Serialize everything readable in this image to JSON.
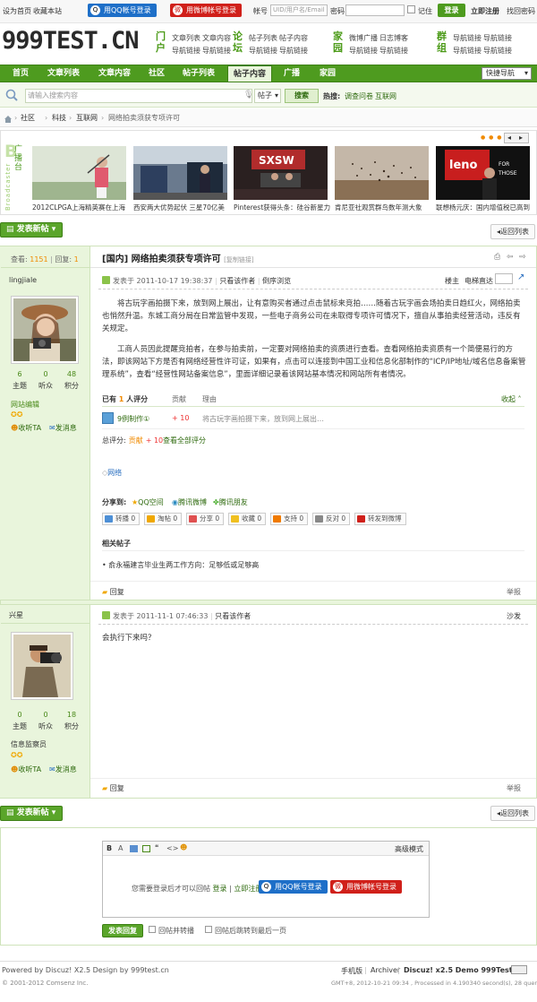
{
  "topbar": {
    "set_home": "设为首页",
    "bookmark": "收藏本站",
    "qq_login": "用QQ帐号登录",
    "weibo_login": "用微博帐号登录",
    "account_label": "帐号",
    "account_placeholder": "UID/用户名/Email",
    "password_label": "密码",
    "remember": "记住",
    "login": "登录",
    "register": "立即注册",
    "forgot": "找回密码"
  },
  "logo": "999TEST.CN",
  "subnav": [
    {
      "head": "门户",
      "items": [
        "文章列表",
        "文章内容",
        "导航链接",
        "导航链接"
      ]
    },
    {
      "head": "论坛",
      "items": [
        "帖子列表",
        "帖子内容",
        "导航链接",
        "导航链接"
      ]
    },
    {
      "head": "家园",
      "items": [
        "微博广播",
        "日志博客",
        "导航链接",
        "导航链接"
      ]
    },
    {
      "head": "群组",
      "items": [
        "导航链接",
        "导航链接",
        "导航链接",
        "导航链接"
      ]
    }
  ],
  "mainnav": {
    "items": [
      "首页",
      "文章列表",
      "文章内容",
      "社区",
      "帖子列表",
      "帖子内容",
      "广播",
      "家园"
    ],
    "active": 5,
    "quick": "快捷导航"
  },
  "search": {
    "placeholder": "请输入搜索内容",
    "scope": "帖子",
    "button": "搜索",
    "hot_label": "热搜:",
    "hot": [
      "调查问卷",
      "互联网"
    ]
  },
  "breadcrumb": [
    "社区",
    "科技",
    "互联网",
    "网络拍卖须获专项许可"
  ],
  "broadcast": {
    "label": "广播台",
    "side_text": "Broadcaster",
    "dots": "● ● ●",
    "items": [
      "2012CLPGA上海精英赛在上海",
      "西安两大优势起伏 三星70亿美",
      "Pinterest获得头条：硅谷新星力",
      "肯尼亚社观赏群鸟数年测大象",
      "联想杨元庆：国内增值税已高到"
    ]
  },
  "actions": {
    "new_post": "发表新帖",
    "back_list": "返回列表"
  },
  "thread": {
    "views_label": "查看:",
    "views": "1151",
    "replies_label": "回复:",
    "replies": "1",
    "category": "[国内]",
    "title": "网络拍卖须获专项许可",
    "copy_link": "[复制链接]"
  },
  "post1": {
    "author": "lingjiale",
    "meta": "发表于 2011-10-17 19:38:37",
    "only_author": "只看该作者",
    "reverse": "倒序浏览",
    "floor": "楼主",
    "teleport": "电梯直达",
    "para1": "将古玩字画拍摄下来，放到网上展出，让有意购买者通过点击鼠标来竞拍……随着古玩字画会场拍卖日趋红火，网络拍卖也悄然升温。东城工商分局在日常监管中发现，一些电子商务公司在未取得专项许可情况下，擅自从事拍卖经营活动，违反有关规定。",
    "para2": "工商人员因此提醒竞拍者，在参与拍卖前，一定要对网络拍卖的资质进行查看。查看网络拍卖资质有一个简便易行的方法，即该网站下方是否有网络经营性许可证，如果有，点击可以连接到中国工业和信息化部制作的“ICP/IP地址/域名信息备案管理系统”，查看“经营性网站备案信息”，里面详细记录着该网站基本情况和网站所有者情况。",
    "stats": [
      {
        "n": "6",
        "l": "主题"
      },
      {
        "n": "0",
        "l": "听众"
      },
      {
        "n": "48",
        "l": "积分"
      }
    ],
    "rank": "网站编辑",
    "follow": "收听TA",
    "message": "发消息",
    "rate": {
      "count_prefix": "已有",
      "count": "1",
      "count_suffix": "人评分",
      "col_contrib": "贡献",
      "col_reason": "理由",
      "collapse": "收起",
      "user": "9例制作①",
      "value": "+ 10",
      "reason": "将古玩字画拍摄下来，放到网上展出…",
      "total_label": "总评分:",
      "total_item": "贡献",
      "total_value": "+ 10",
      "view_all": "查看全部评分"
    },
    "tag": "网络",
    "share_label": "分享到:",
    "share_targets": [
      "QQ空间",
      "腾讯微博",
      "腾讯朋友"
    ],
    "buttons": [
      "转播 0",
      "淘帖 0",
      "分享 0",
      "收藏 0",
      "支持 0",
      "反对 0",
      "转发到微博"
    ],
    "related_title": "相关帖子",
    "related": [
      "俞永福建言毕业生两工作方向：足够低或足够高"
    ],
    "reply": "回复",
    "report": "举报"
  },
  "post2": {
    "author": "兴星",
    "meta": "发表于 2011-11-1 07:46:33",
    "only_author": "只看该作者",
    "floor": "沙发",
    "text": "会执行下来吗？",
    "stats": [
      {
        "n": "0",
        "l": "主题"
      },
      {
        "n": "0",
        "l": "听众"
      },
      {
        "n": "18",
        "l": "积分"
      }
    ],
    "rank": "信息监察员",
    "follow": "收听TA",
    "message": "发消息",
    "reply": "回复",
    "report": "举报"
  },
  "editor": {
    "advanced": "高级模式",
    "need_login": "您需要登录后才可以回帖",
    "login": "登录",
    "sep": "|",
    "register": "立即注册",
    "submit": "发表回复",
    "opt1": "回帖并转播",
    "opt2": "回帖后跳转到最后一页"
  },
  "footer": {
    "powered": "Powered by Discuz! X2.5 Design by 999test.cn",
    "copyright": "© 2001-2012 Comsenz Inc.",
    "mobile": "手机版",
    "archiver": "Archiver",
    "demo": "Discuz! x2.5 Demo 999Test.cn",
    "stats": "GMT+8, 2012-10-21 09:34 , Processed in 4.190340 second(s), 28 queries ."
  },
  "colors": {
    "accent": "#4e9b1f",
    "light": "#e9f5dc",
    "orange": "#f08a00"
  }
}
